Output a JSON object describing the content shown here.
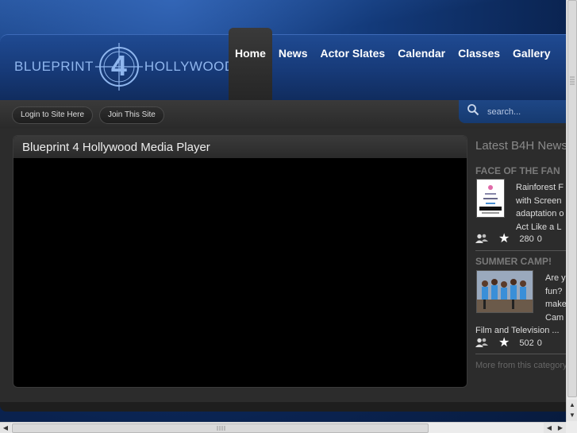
{
  "logo": {
    "left_text": "BLUEPRINT",
    "numeral": "4",
    "right_text": "HOLLYWOOD"
  },
  "nav": {
    "items": [
      {
        "label": "Home",
        "active": true
      },
      {
        "label": "News"
      },
      {
        "label": "Actor Slates"
      },
      {
        "label": "Calendar"
      },
      {
        "label": "Classes"
      },
      {
        "label": "Gallery"
      }
    ]
  },
  "account": {
    "login_label": "Login to Site Here",
    "join_label": "Join This Site"
  },
  "search": {
    "placeholder": "search..."
  },
  "player": {
    "title": "Blueprint 4 Hollywood Media Player"
  },
  "sidebar": {
    "heading": "Latest B4H News",
    "articles": [
      {
        "title": "FACE OF THE FAN",
        "excerpt": [
          "Rainforest F",
          "with Screen",
          "adaptation o",
          "Act Like a L"
        ],
        "views": "280",
        "rating": "0"
      },
      {
        "title": "SUMMER CAMP!",
        "excerpt": [
          "Are y",
          "fun?",
          "make",
          "Cam"
        ],
        "excerpt_tail": "Film and Television ...",
        "views": "502",
        "rating": "0"
      }
    ],
    "more_link": "More from this category"
  },
  "colors": {
    "accent_blue": "#1f4a92",
    "panel": "#2c2c2c"
  },
  "icons": {
    "search": "search-icon",
    "views": "users-icon",
    "rating": "star-icon"
  }
}
